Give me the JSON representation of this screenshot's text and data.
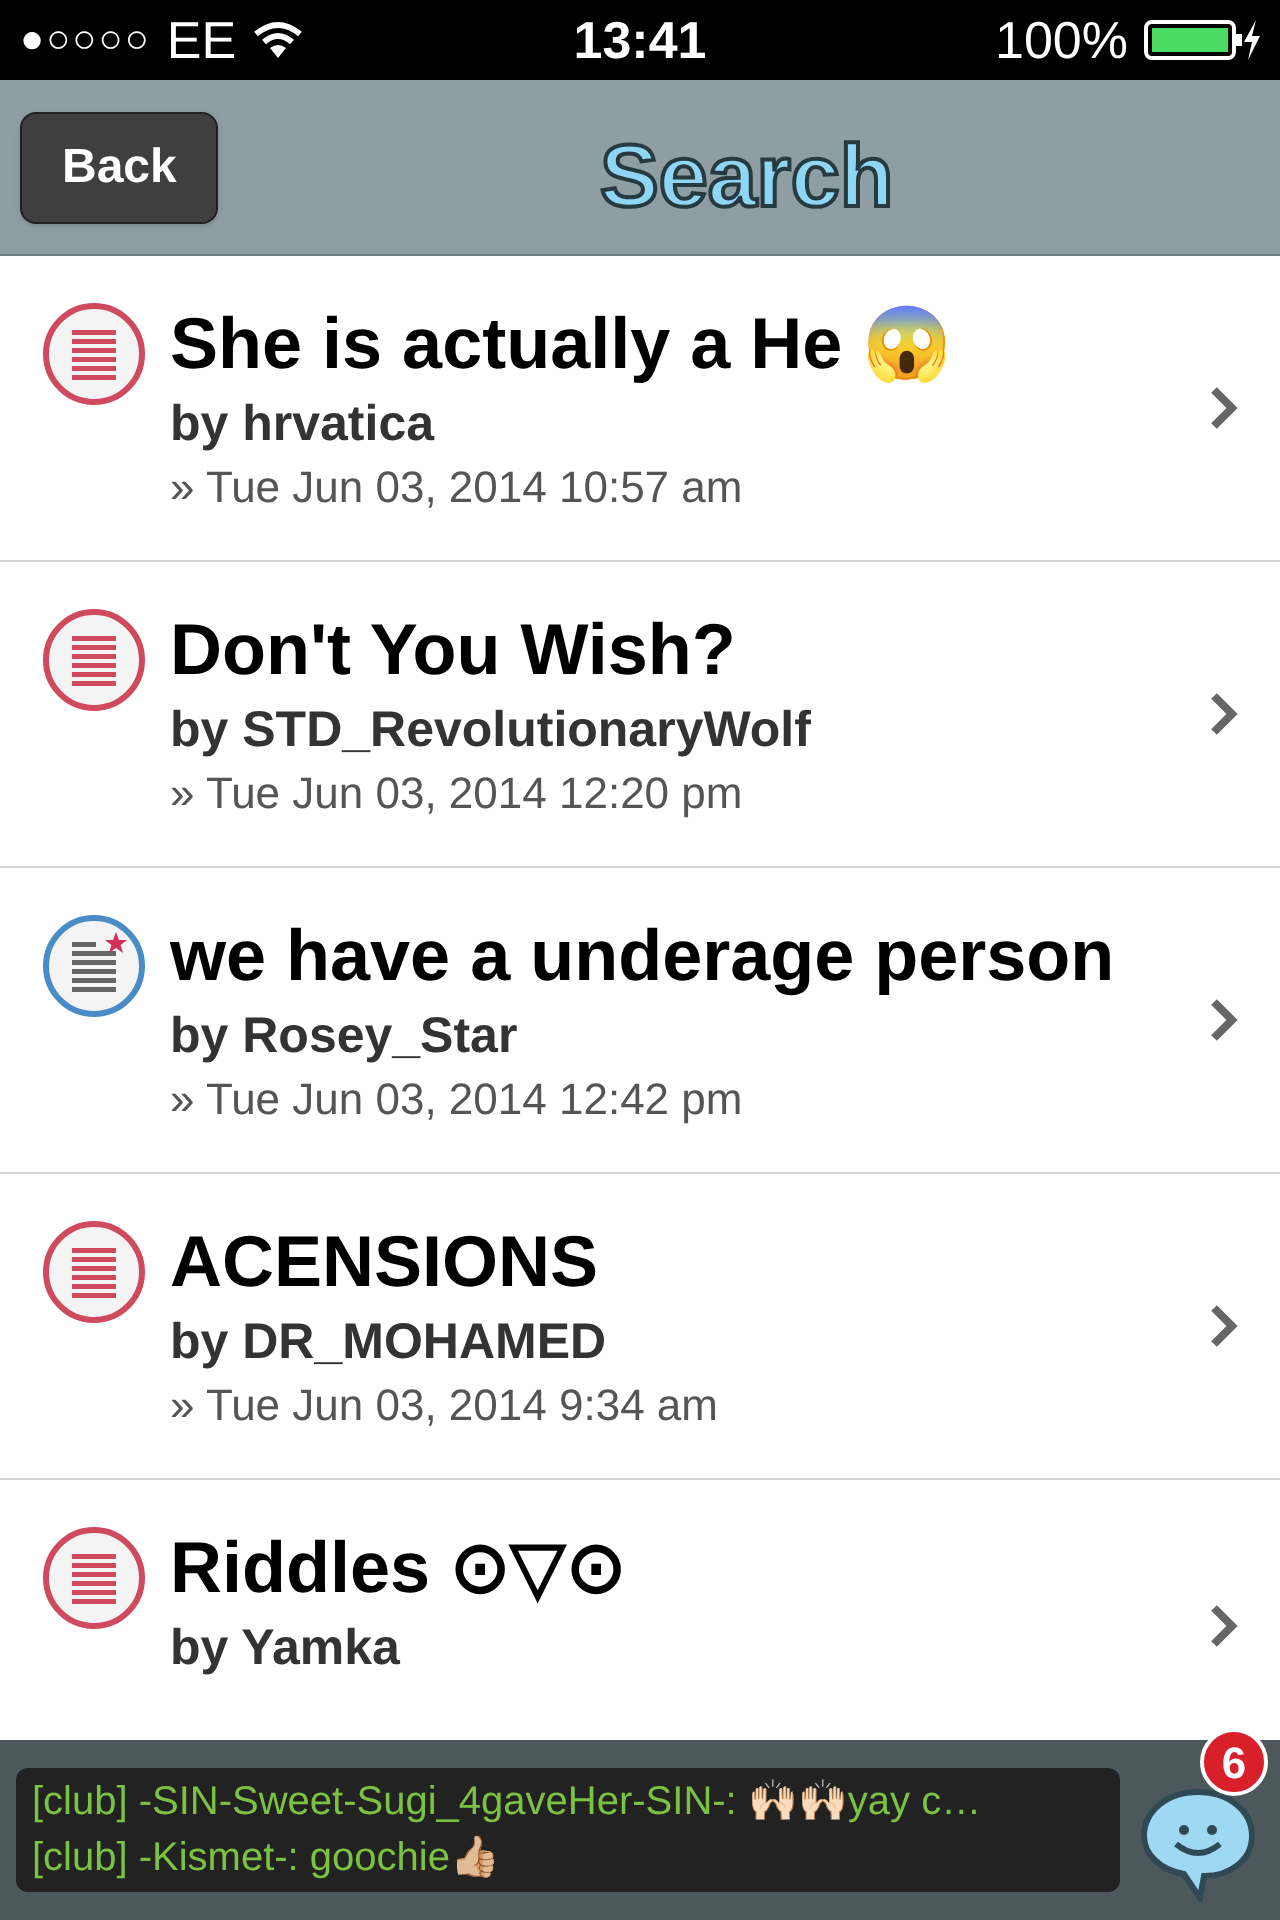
{
  "status_bar": {
    "signal_dots": "●○○○○",
    "carrier": "EE",
    "time": "13:41",
    "battery": "100%"
  },
  "nav": {
    "back": "Back",
    "title": "Search"
  },
  "results": [
    {
      "title": "She is actually a He 😱",
      "author": "by hrvatica",
      "date": "» Tue Jun 03, 2014 10:57 am",
      "unread": false
    },
    {
      "title": "Don't You Wish?",
      "author": "by STD_RevolutionaryWolf",
      "date": "» Tue Jun 03, 2014 12:20 pm",
      "unread": false
    },
    {
      "title": "we have a underage person",
      "author": "by Rosey_Star",
      "date": "» Tue Jun 03, 2014 12:42 pm",
      "unread": true
    },
    {
      "title": "ACENSIONS",
      "author": "by DR_MOHAMED",
      "date": "» Tue Jun 03, 2014 9:34 am",
      "unread": false
    },
    {
      "title": "Riddles ⊙▽⊙",
      "author": "by Yamka",
      "unread": false
    }
  ],
  "chat": {
    "messages": [
      "[club] -SIN-Sweet-Sugi_4gaveHer-SIN-: 🙌🏻🙌🏻yay c…",
      "[club] -Kismet-: goochie👍🏼"
    ],
    "badge": "6"
  }
}
